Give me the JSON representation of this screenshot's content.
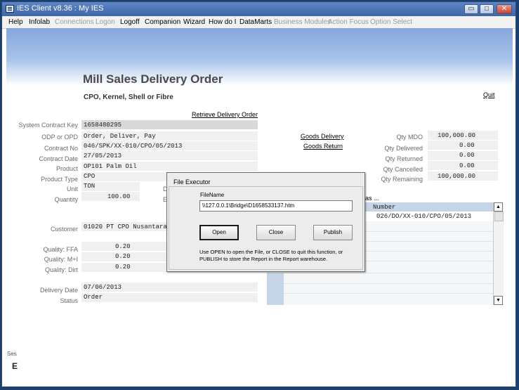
{
  "window": {
    "title": "IES Client v8.36 : My IES",
    "min": "▭",
    "max": "□",
    "close": "✕"
  },
  "menu": [
    {
      "label": "Help",
      "enabled": true
    },
    {
      "label": "Infolab",
      "enabled": true
    },
    {
      "label": "Connections",
      "enabled": false
    },
    {
      "label": "Logon",
      "enabled": false
    },
    {
      "label": "Logoff",
      "enabled": true
    },
    {
      "label": "Companion",
      "enabled": true
    },
    {
      "label": "Wizard",
      "enabled": true
    },
    {
      "label": "How do I",
      "enabled": true
    },
    {
      "label": "DataMarts",
      "enabled": true
    },
    {
      "label": "Business Modules",
      "enabled": false
    },
    {
      "label": "Action Focus",
      "enabled": false
    },
    {
      "label": "Option Select",
      "enabled": false
    }
  ],
  "page": {
    "title": "Mill Sales Delivery Order",
    "subtitle": "CPO, Kernel, Shell or Fibre",
    "quit": "Quit",
    "retrieve": "Retrieve Delivery Order",
    "goods_delivery": "Goods Delivery",
    "goods_return": "Goods Return"
  },
  "fields": {
    "system_contract_key": {
      "label": "System Contract Key",
      "value": "1658480295"
    },
    "odp_or_opd": {
      "label": "ODP or OPD",
      "value": "Order, Deliver, Pay"
    },
    "contract_no": {
      "label": "Contract No",
      "value": "046/SPK/XX-010/CPO/05/2013"
    },
    "contract_date": {
      "label": "Contract Date",
      "value": "27/05/2013"
    },
    "product": {
      "label": "Product",
      "value": "OP101 Palm Oil"
    },
    "product_type": {
      "label": "Product Type",
      "value": "CPO"
    },
    "unit": {
      "label": "Unit",
      "value": "TON"
    },
    "quantity": {
      "label": "Quantity",
      "value": "100.00"
    },
    "customer": {
      "label": "Customer",
      "value": "01020 PT CPO Nusantara"
    },
    "quality_ffa": {
      "label": "Quality: FFA",
      "value": "0.20"
    },
    "quality_mi": {
      "label": "Quality: M+I",
      "value": "0.20"
    },
    "quality_dirt": {
      "label": "Quality: Dirt",
      "value": "0.20"
    },
    "delivery_date": {
      "label": "Delivery Date",
      "value": "07/06/2013"
    },
    "status": {
      "label": "Status",
      "value": "Order"
    }
  },
  "qty": {
    "mdo": {
      "label": "Qty MDO",
      "value": "100,000.00"
    },
    "delivered": {
      "label": "Qty Delivered",
      "value": "0.00"
    },
    "returned": {
      "label": "Qty Returned",
      "value": "0.00"
    },
    "cancelled": {
      "label": "Qty Cancelled",
      "value": "0.00"
    },
    "remaining": {
      "label": "Qty Remaining",
      "value": "100,000.00"
    }
  },
  "deliveries": {
    "heading": "as ...",
    "column": "Number",
    "rows": [
      "026/DO/XX-010/CPO/05/2013"
    ],
    "partial_d": "D",
    "partial_e": "E"
  },
  "dialog": {
    "title": "File Executor",
    "file_label": "FileName",
    "file_value": "\\\\127.0.0.1\\Bridge\\D1658533137.htm",
    "open": "Open",
    "close": "Close",
    "publish": "Publish",
    "help": "Use OPEN to open the File, or CLOSE to quit this function, or PUBLISH to store the Report in the Report warehouse."
  },
  "status_bar": {
    "label": "Ses",
    "glyph": "E"
  }
}
